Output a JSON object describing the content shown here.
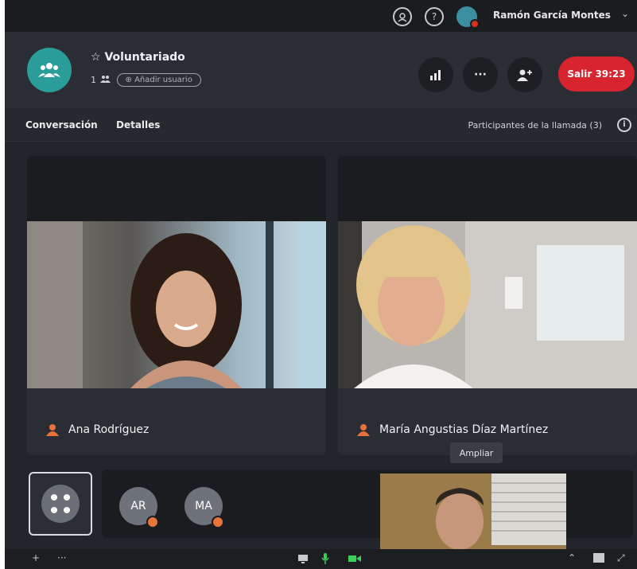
{
  "topbar": {
    "contacts_icon": "contacts-headset-icon",
    "help_icon": "help-icon",
    "help_label": "?",
    "user_name": "Ramón García Montes",
    "chevron": "⌄"
  },
  "header": {
    "star": "☆",
    "title": "Voluntariado",
    "member_count": "1",
    "invite_label": "Añadir usuario",
    "leave_label": "Salir",
    "timer": "39:23"
  },
  "tabs": {
    "conversation": "Conversación",
    "details": "Detalles",
    "participants": "Participantes de la llamada (3)",
    "info": "i"
  },
  "participants": [
    {
      "name": "Ana Rodríguez"
    },
    {
      "name": "María Angustias Díaz Martínez"
    }
  ],
  "strip": {
    "avatars": [
      {
        "initials": "AR"
      },
      {
        "initials": "MA"
      }
    ],
    "tooltip": "Ampliar"
  },
  "bottombar": {
    "plus": "+",
    "more": "···"
  },
  "colors": {
    "accent_teal": "#2a9d9a",
    "leave_red": "#d8242e",
    "presence_orange": "#e8733a"
  }
}
